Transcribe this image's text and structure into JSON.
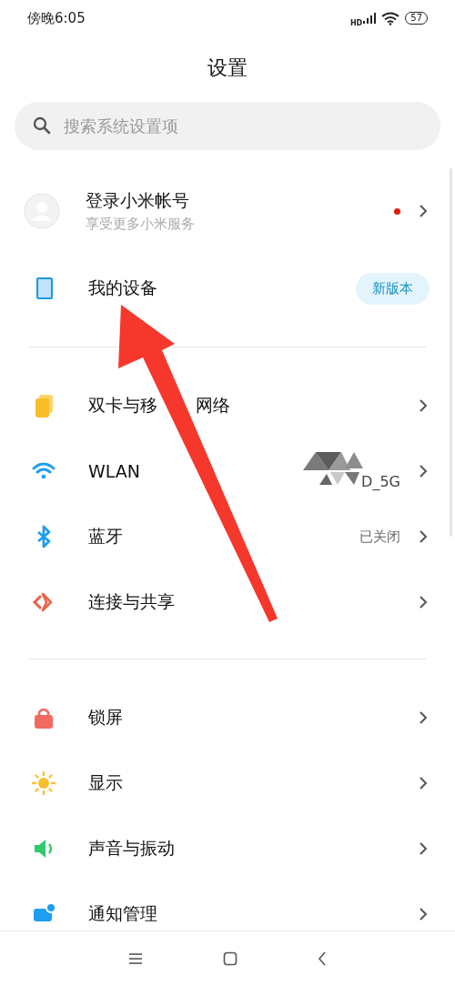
{
  "status_bar": {
    "time": "傍晚6:05",
    "network_tag": "HD",
    "battery": "57"
  },
  "title": "设置",
  "search": {
    "placeholder": "搜索系统设置项"
  },
  "account": {
    "title": "登录小米帐号",
    "subtitle": "享受更多小米服务",
    "notification": true
  },
  "sections": [
    [
      {
        "label": "我的设备",
        "badge": "新版本"
      }
    ],
    [
      {
        "label": "双卡与移",
        "label_tail": "网络"
      },
      {
        "label": "WLAN",
        "value": "D_5G",
        "redacted": true
      },
      {
        "label": "蓝牙",
        "value": "已关闭"
      },
      {
        "label": "连接与共享"
      }
    ],
    [
      {
        "label": "锁屏"
      },
      {
        "label": "显示"
      },
      {
        "label": "声音与振动"
      },
      {
        "label": "通知管理"
      }
    ]
  ],
  "annotation": {
    "kind": "arrow"
  }
}
